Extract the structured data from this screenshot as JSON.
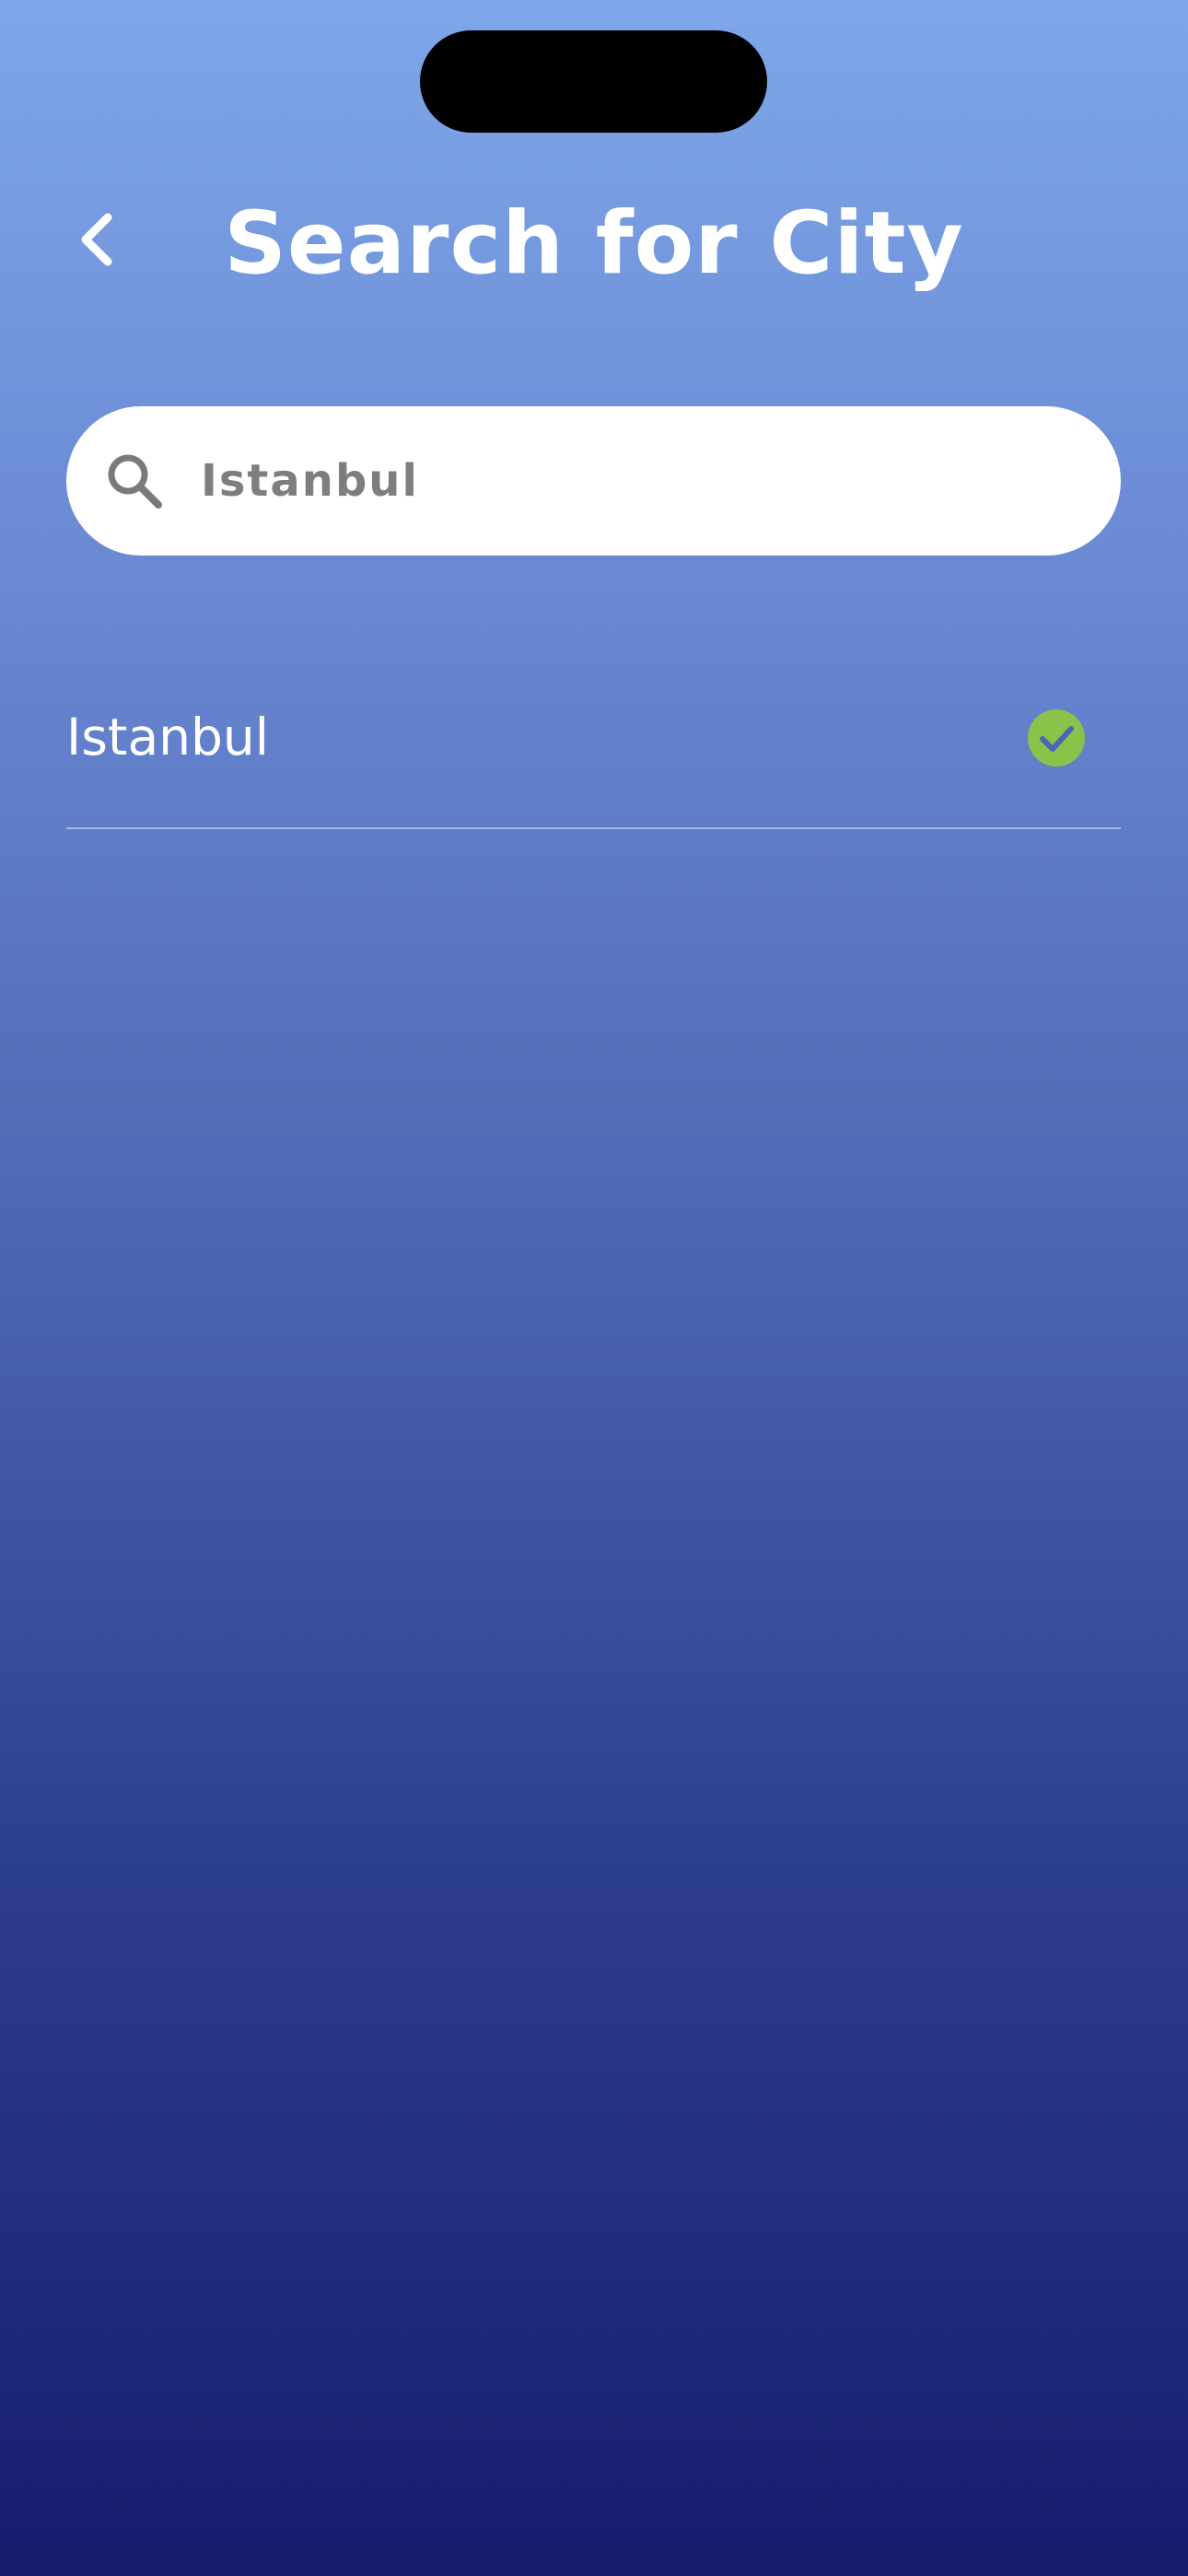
{
  "header": {
    "title": "Search for City",
    "back_icon": "chevron-left-icon"
  },
  "search": {
    "value": "Istanbul",
    "icon": "search-icon"
  },
  "results": [
    {
      "label": "Istanbul",
      "selected": true,
      "status_icon": "check-circle-icon"
    }
  ],
  "colors": {
    "gradient_top": "#7ea6e9",
    "gradient_bottom": "#171c6d",
    "check_green": "#8bc34a",
    "text_white": "#ffffff",
    "search_text": "#7e7e7e"
  }
}
